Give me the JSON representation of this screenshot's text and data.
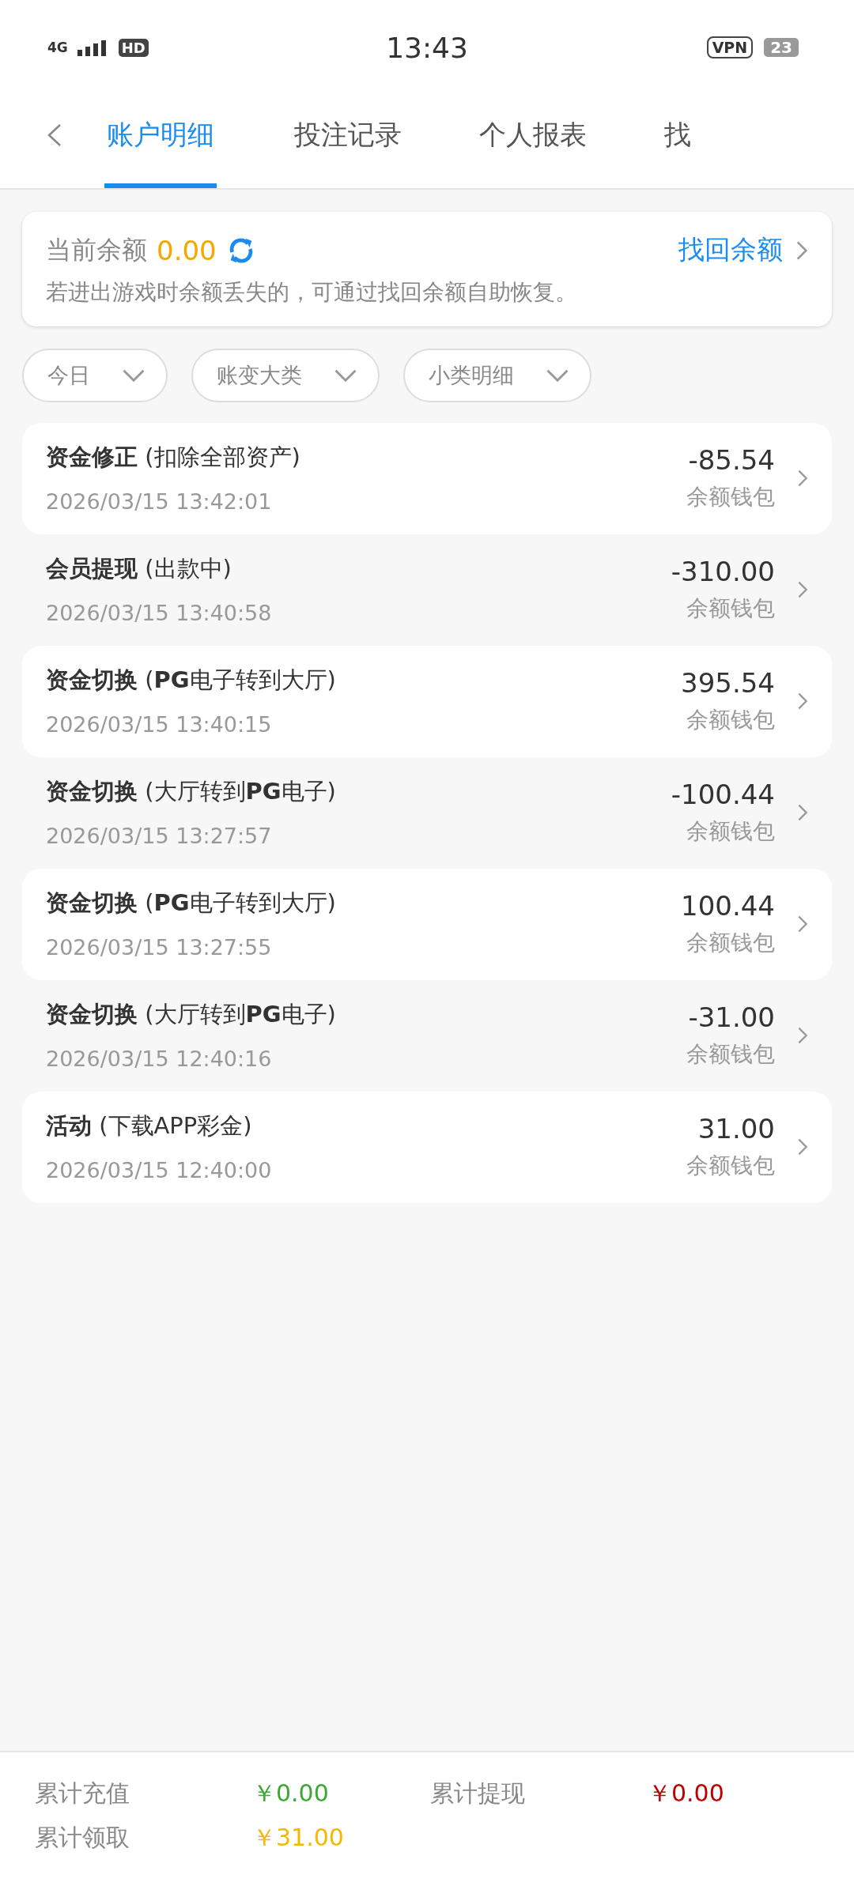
{
  "status_bar": {
    "network": "4G",
    "hd": "HD",
    "time": "13:43",
    "vpn": "VPN",
    "battery": "23"
  },
  "tabs": [
    {
      "label": "账户明细",
      "selected": true
    },
    {
      "label": "投注记录",
      "selected": false
    },
    {
      "label": "个人报表",
      "selected": false
    },
    {
      "label": "找",
      "selected": false
    }
  ],
  "balance_card": {
    "label": "当前余额",
    "amount": "0.00",
    "link": "找回余额",
    "note": "若进出游戏时余额丢失的，可通过找回余额自助恢复。"
  },
  "filters": [
    {
      "label": "今日"
    },
    {
      "label": "账变大类"
    },
    {
      "label": "小类明细"
    }
  ],
  "records": [
    {
      "title": "资金修正",
      "detail": "(扣除全部资产)",
      "time": "2026/03/15 13:42:01",
      "amount": "-85.54",
      "wallet": "余额钱包"
    },
    {
      "title": "会员提现",
      "detail": "(出款中)",
      "time": "2026/03/15 13:40:58",
      "amount": "-310.00",
      "wallet": "余额钱包"
    },
    {
      "title": "资金切换",
      "detail": "(**PG**电子转到大厅)",
      "time": "2026/03/15 13:40:15",
      "amount": "395.54",
      "wallet": "余额钱包"
    },
    {
      "title": "资金切换",
      "detail": "(大厅转到**PG**电子)",
      "time": "2026/03/15 13:27:57",
      "amount": "-100.44",
      "wallet": "余额钱包"
    },
    {
      "title": "资金切换",
      "detail": "(**PG**电子转到大厅)",
      "time": "2026/03/15 13:27:55",
      "amount": "100.44",
      "wallet": "余额钱包"
    },
    {
      "title": "资金切换",
      "detail": "(大厅转到**PG**电子)",
      "time": "2026/03/15 12:40:16",
      "amount": "-31.00",
      "wallet": "余额钱包"
    },
    {
      "title": "活动",
      "detail": "(下载APP彩金)",
      "time": "2026/03/15 12:40:00",
      "amount": "31.00",
      "wallet": "余额钱包"
    }
  ],
  "totals": [
    {
      "label": "累计充值",
      "value": "￥0.00",
      "color": "#3aaa35"
    },
    {
      "label": "累计提现",
      "value": "￥0.00",
      "color": "#c00000"
    },
    {
      "label": "累计领取",
      "value": "￥31.00",
      "color": "#f5b800"
    }
  ]
}
